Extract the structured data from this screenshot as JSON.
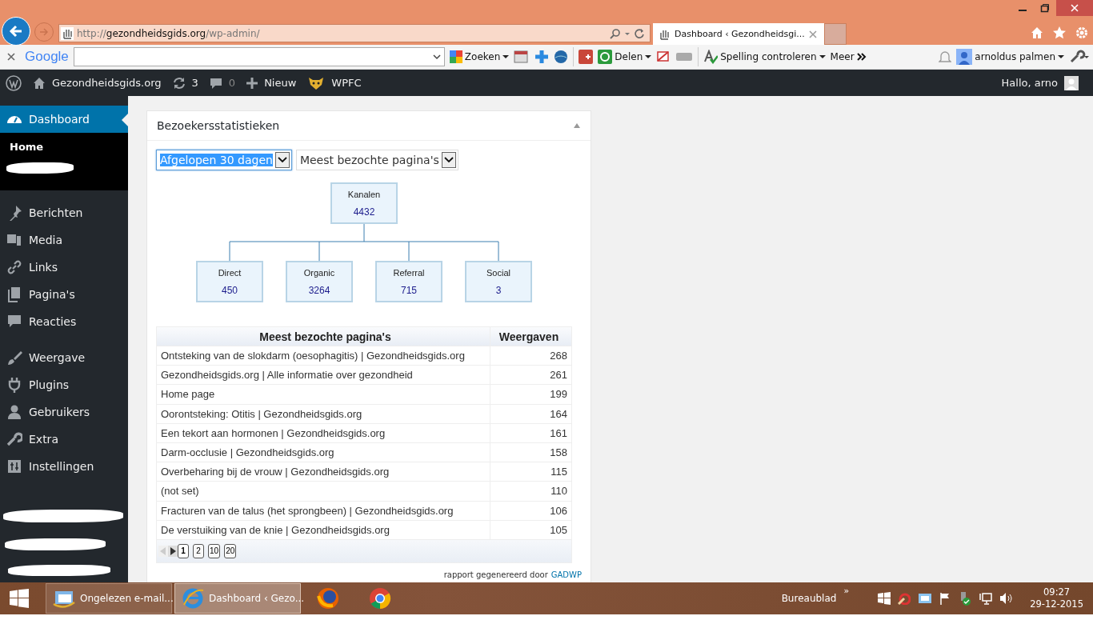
{
  "browser": {
    "url": "http://**gezondheidsgids.org**/wp-admin/",
    "tab": {
      "title": "Dashboard ‹ Gezondheidsgi..."
    }
  },
  "toolbar": {
    "logo": "Google",
    "items": [
      "Zoeken",
      "Delen",
      "Spelling controleren",
      "Meer"
    ],
    "user": "arnoldus palmen"
  },
  "admin_bar": {
    "site": "Gezondheidsgids.org",
    "updates": "3",
    "comments": "0",
    "new": "Nieuw",
    "plugin": "WPFC",
    "greeting": "Hallo, arno"
  },
  "sidebar": {
    "groups": [
      [
        {
          "label": "Dashboard",
          "selected": true,
          "children": [
            {
              "label": "Home",
              "selected": true
            }
          ]
        }
      ],
      [
        {
          "label": "Berichten",
          "selected": false
        },
        {
          "label": "Media",
          "selected": false
        },
        {
          "label": "Links",
          "selected": false
        },
        {
          "label": "Pagina's",
          "selected": false
        },
        {
          "label": "Reacties",
          "selected": false
        }
      ],
      [
        {
          "label": "Weergave",
          "selected": false
        },
        {
          "label": "Plugins",
          "selected": false
        },
        {
          "label": "Gebruikers",
          "selected": false
        },
        {
          "label": "Extra",
          "selected": false
        },
        {
          "label": "Instellingen",
          "selected": false
        }
      ]
    ]
  },
  "widget": {
    "title": "Bezoekersstatistieken",
    "expanded": true,
    "selects": [
      {
        "value": "Afgelopen 30 dagen",
        "focused": true
      },
      {
        "value": "Meest bezochte pagina's",
        "focused": false
      }
    ],
    "org_chart": {
      "root": {
        "label": "Kanalen",
        "value": "4432"
      },
      "children": [
        {
          "label": "Direct",
          "value": "450"
        },
        {
          "label": "Organic",
          "value": "3264"
        },
        {
          "label": "Referral",
          "value": "715"
        },
        {
          "label": "Social",
          "value": "3"
        }
      ]
    },
    "table": {
      "columns": [
        "Meest bezochte pagina's",
        "Weergaven"
      ],
      "rows": [
        [
          "Ontsteking van de slokdarm (oesophagitis) | Gezondheidsgids.org",
          "268"
        ],
        [
          "Gezondheidsgids.org | Alle informatie over gezondheid",
          "261"
        ],
        [
          "Home page",
          "199"
        ],
        [
          "Oorontsteking: Otitis | Gezondheidsgids.org",
          "164"
        ],
        [
          "Een tekort aan hormonen | Gezondheidsgids.org",
          "161"
        ],
        [
          "Darm-occlusie | Gezondheidsgids.org",
          "158"
        ],
        [
          "Overbeharing bij de vrouw | Gezondheidsgids.org",
          "115"
        ],
        [
          "(not set)",
          "110"
        ],
        [
          "Fracturen van de talus (het sprongbeen) | Gezondheidsgids.org",
          "106"
        ],
        [
          "De verstuiking van de knie | Gezondheidsgids.org",
          "105"
        ]
      ],
      "pager": {
        "prev_disabled": true,
        "pages": [
          {
            "label": "1",
            "selected": true
          },
          {
            "label": "2",
            "selected": false
          },
          {
            "label": "10",
            "selected": false
          },
          {
            "label": "20",
            "selected": false
          }
        ]
      }
    },
    "footer": {
      "text": "rapport gegenereerd door",
      "link": "GADWP"
    }
  },
  "taskbar": {
    "windows": [
      {
        "label": "Ongelezen e-mail...",
        "selected": false
      },
      {
        "label": "Dashboard ‹ Gezo...",
        "selected": true
      }
    ],
    "desktop": "Bureaublad",
    "overflow": "»",
    "time": "09:27",
    "date": "29-12-2015"
  }
}
